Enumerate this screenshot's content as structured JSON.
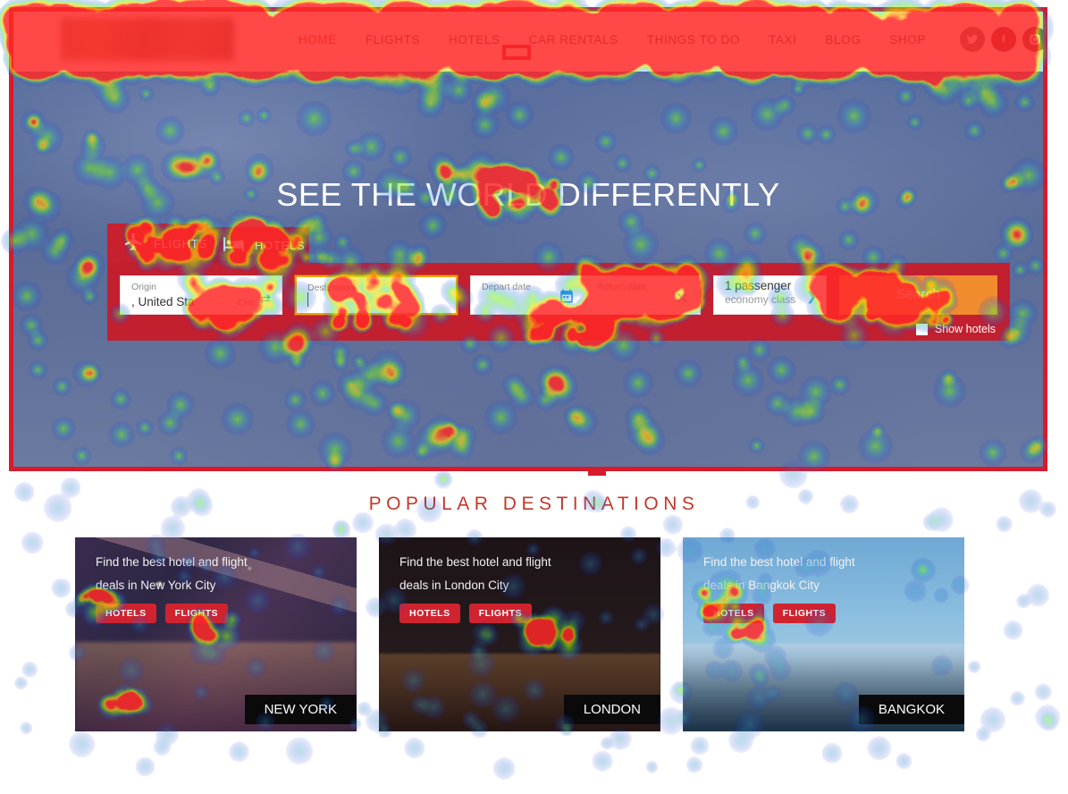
{
  "header": {
    "logo_alt": "site-logo",
    "nav": [
      {
        "label": "HOME",
        "active": true
      },
      {
        "label": "FLIGHTS",
        "active": false
      },
      {
        "label": "HOTELS",
        "active": false
      },
      {
        "label": "CAR RENTALS",
        "active": false
      },
      {
        "label": "THINGS TO DO",
        "active": false
      },
      {
        "label": "TAXI",
        "active": false
      },
      {
        "label": "BLOG",
        "active": false
      },
      {
        "label": "SHOP",
        "active": false
      }
    ],
    "social": [
      {
        "name": "twitter-icon",
        "color": "#6b5f70"
      },
      {
        "name": "facebook-icon",
        "color": "#7a2540"
      },
      {
        "name": "instagram-icon",
        "color": "#6e3a4a"
      }
    ]
  },
  "hero": {
    "title": "SEE THE WORLD DIFFERENTLY"
  },
  "booking": {
    "tabs": [
      {
        "label": "FLIGHTS",
        "icon": "airplane-icon",
        "active": true
      },
      {
        "label": "HOTELS",
        "icon": "bed-icon",
        "active": false
      }
    ],
    "origin": {
      "label": "Origin",
      "value": ", United Sta",
      "code": "CHI"
    },
    "destination": {
      "label": "Destination",
      "value": ""
    },
    "depart": {
      "label": "Depart date",
      "value": ""
    },
    "return": {
      "label": "Return date",
      "value": ""
    },
    "passengers": {
      "line1": "1 passenger",
      "line2": "economy class"
    },
    "search_label": "Search",
    "show_hotels_label": "Show hotels",
    "accent_red": "#c2202f",
    "accent_orange": "#f08c2e",
    "focus_yellow": "#f0a800"
  },
  "popular": {
    "title": "POPULAR DESTINATIONS",
    "cards": [
      {
        "line1": "Find the best hotel and flight",
        "line2": "deals in New York City",
        "badges": [
          "HOTELS",
          "FLIGHTS"
        ],
        "city": "NEW YORK"
      },
      {
        "line1": "Find the best hotel and flight",
        "line2": "deals in London City",
        "badges": [
          "HOTELS",
          "FLIGHTS"
        ],
        "city": "LONDON"
      },
      {
        "line1": "Find the best hotel and flight",
        "line2": "deals in Bangkok City",
        "badges": [
          "HOTELS",
          "FLIGHTS"
        ],
        "city": "BANGKOK"
      }
    ]
  }
}
